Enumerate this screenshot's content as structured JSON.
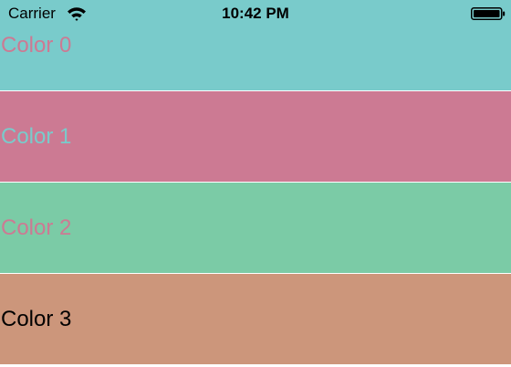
{
  "status_bar": {
    "carrier": "Carrier",
    "time": "10:42 PM",
    "icons": [
      "wifi-icon",
      "battery-icon"
    ]
  },
  "rows": [
    {
      "label": "Color 0",
      "background": "#79cbcb",
      "text_color": "#cc7a93"
    },
    {
      "label": "Color 1",
      "background": "#cc7a93",
      "text_color": "#79cbcb"
    },
    {
      "label": "Color 2",
      "background": "#7bcba6",
      "text_color": "#cc7a93"
    },
    {
      "label": "Color 3",
      "background": "#cc967b",
      "text_color": "#000000"
    }
  ]
}
